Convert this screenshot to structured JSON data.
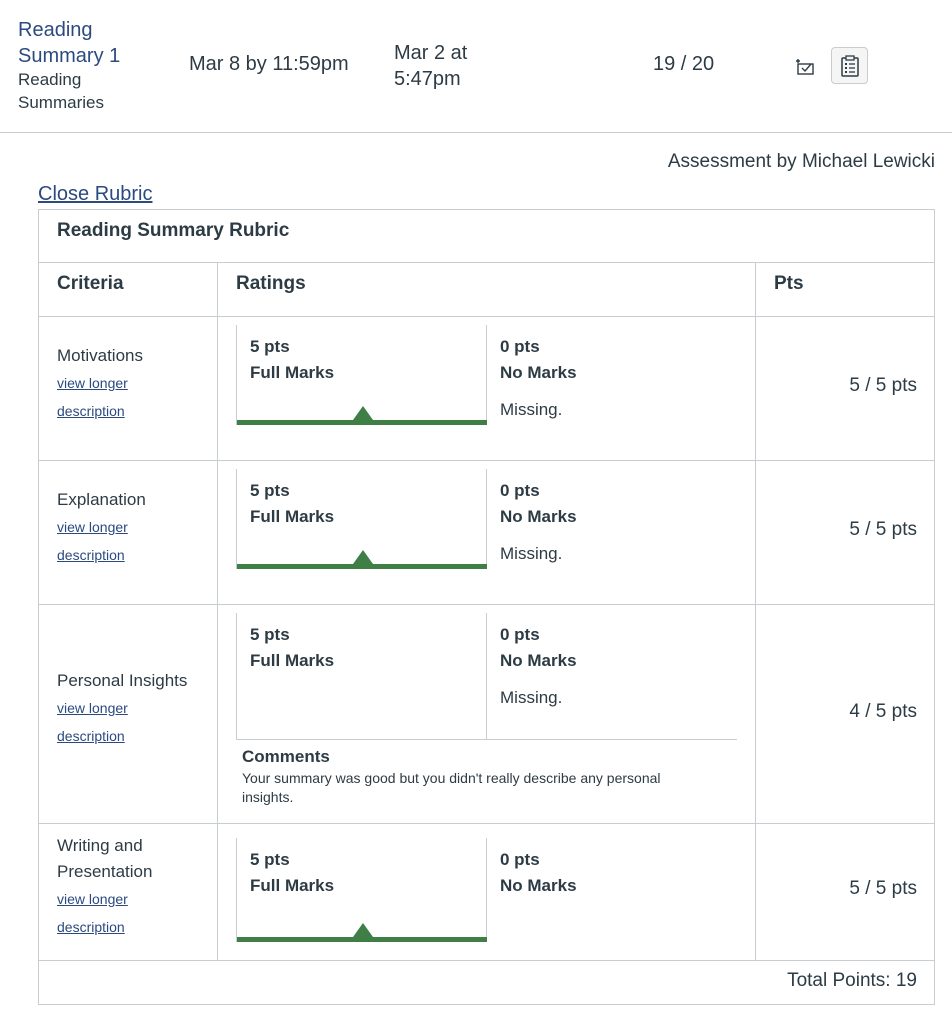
{
  "assignment": {
    "name": "Reading Summary 1",
    "group": "Reading Summaries",
    "due": "Mar 8 by 11:59pm",
    "submitted": "Mar 2 at 5:47pm",
    "score": "19 / 20"
  },
  "assessor": "Assessment by Michael Lewicki",
  "close_rubric_label": "Close Rubric",
  "rubric": {
    "title": "Reading Summary Rubric",
    "headers": {
      "criteria": "Criteria",
      "ratings": "Ratings",
      "pts": "Pts"
    },
    "criteria": [
      {
        "description": "Motivations",
        "link_1": "view longer",
        "link_2": "description",
        "tiers": [
          {
            "pts": "5 pts",
            "label": "Full Marks",
            "desc": ""
          },
          {
            "pts": "0 pts",
            "label": "No Marks",
            "desc": "Missing."
          }
        ],
        "selected_tier": 0,
        "points": "5 / 5 pts"
      },
      {
        "description": "Explanation",
        "link_1": "view longer",
        "link_2": "description",
        "tiers": [
          {
            "pts": "5 pts",
            "label": "Full Marks",
            "desc": ""
          },
          {
            "pts": "0 pts",
            "label": "No Marks",
            "desc": "Missing."
          }
        ],
        "selected_tier": 0,
        "points": "5 / 5 pts"
      },
      {
        "description": "Personal Insights",
        "link_1": "view longer",
        "link_2": "description",
        "tiers": [
          {
            "pts": "5 pts",
            "label": "Full Marks",
            "desc": ""
          },
          {
            "pts": "0 pts",
            "label": "No Marks",
            "desc": "Missing."
          }
        ],
        "selected_tier": null,
        "comments_title": "Comments",
        "comments": "Your summary was good but you didn't really describe any personal insights.",
        "points": "4 / 5 pts"
      },
      {
        "description": "Writing and Presentation",
        "link_1": "view longer",
        "link_2": "description",
        "tiers": [
          {
            "pts": "5 pts",
            "label": "Full Marks",
            "desc": ""
          },
          {
            "pts": "0 pts",
            "label": "No Marks",
            "desc": ""
          }
        ],
        "selected_tier": 0,
        "points": "5 / 5 pts"
      }
    ],
    "total": "Total Points: 19"
  },
  "colors": {
    "link": "#2b4a7f",
    "text": "#2d3b45",
    "border": "#c7cdd1",
    "selected": "#3f7f46"
  },
  "icons": {
    "comments": "comment-check-icon",
    "rubric": "rubric-clipboard-icon"
  }
}
